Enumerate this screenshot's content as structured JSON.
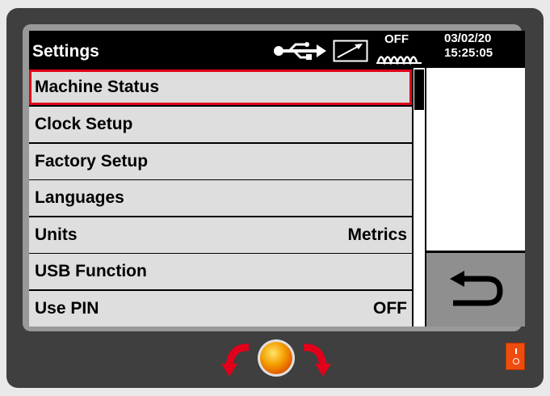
{
  "header": {
    "title": "Settings",
    "status_off": "OFF",
    "date": "03/02/20",
    "time": "15:25:05",
    "icons": [
      "usb-icon",
      "trend-arrow-icon",
      "wave-icon"
    ]
  },
  "menu": {
    "items": [
      {
        "label": "Machine Status",
        "value": "",
        "selected": true
      },
      {
        "label": "Clock Setup",
        "value": ""
      },
      {
        "label": "Factory Setup",
        "value": ""
      },
      {
        "label": "Languages",
        "value": ""
      },
      {
        "label": "Units",
        "value": "Metrics"
      },
      {
        "label": "USB Function",
        "value": ""
      },
      {
        "label": "Use PIN",
        "value": "OFF"
      }
    ]
  },
  "side_panel": {
    "back_icon": "return-arrow-icon"
  },
  "controls": {
    "knob_icon": "rotary-knob-icon",
    "power_icon": "power-switch-icon"
  },
  "colors": {
    "selection": "#e2001a",
    "row_bg": "#dedede",
    "knob": "#f5a000",
    "arrows": "#e2001a",
    "power": "#f04c0f"
  }
}
